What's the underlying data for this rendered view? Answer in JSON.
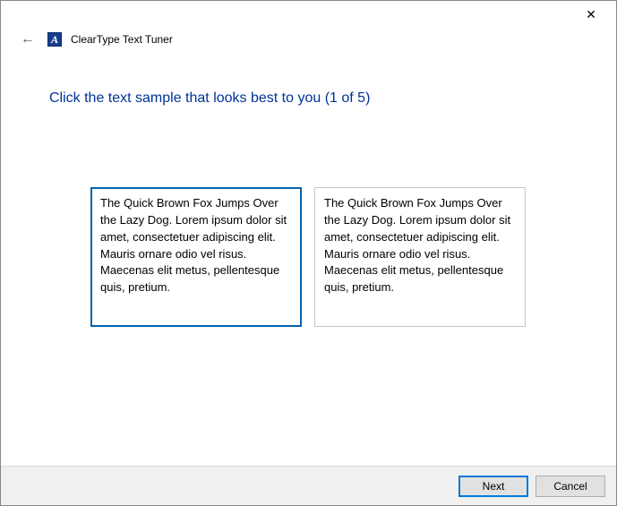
{
  "window": {
    "close_glyph": "✕"
  },
  "header": {
    "back_glyph": "←",
    "app_icon_letter": "A",
    "app_title": "ClearType Text Tuner"
  },
  "main": {
    "heading": "Click the text sample that looks best to you (1 of 5)",
    "samples": [
      {
        "text": "The Quick Brown Fox Jumps Over the Lazy Dog. Lorem ipsum dolor sit amet, consectetuer adipiscing elit. Mauris ornare odio vel risus. Maecenas elit metus, pellentesque quis, pretium.",
        "selected": true
      },
      {
        "text": "The Quick Brown Fox Jumps Over the Lazy Dog. Lorem ipsum dolor sit amet, consectetuer adipiscing elit. Mauris ornare odio vel risus. Maecenas elit metus, pellentesque quis, pretium.",
        "selected": false
      }
    ]
  },
  "footer": {
    "next_label": "Next",
    "cancel_label": "Cancel"
  }
}
